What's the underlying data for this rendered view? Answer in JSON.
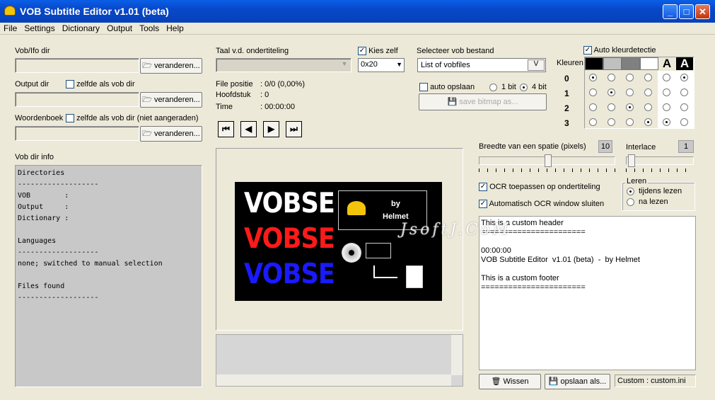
{
  "window": {
    "title": "VOB Subtitle Editor v1.01 (beta)",
    "min": "_",
    "max": "□",
    "close": "✕"
  },
  "menu": [
    "File",
    "Settings",
    "Dictionary",
    "Output",
    "Tools",
    "Help"
  ],
  "left": {
    "vobifo_label": "Vob/Ifo dir",
    "output_label": "Output dir",
    "output_same": "zelfde als vob dir",
    "dict_label": "Woordenboek",
    "dict_same": "zelfde als vob dir (niet aangeraden)",
    "change_btn": "veranderen...",
    "info_label": "Vob dir info",
    "info_text": "Directories\n-------------------\nVOB        :\nOutput     :\nDictionary :\n\nLanguages\n-------------------\nnone; switched to manual selection\n\nFiles found\n-------------------"
  },
  "mid": {
    "lang_label": "Taal v.d. ondertiteling",
    "kies_zelf": "Kies zelf",
    "hex_value": "0x20",
    "file_pos_label": "File positie",
    "file_pos_value": ": 0/0  (0,00%)",
    "chapter_label": "Hoofdstuk",
    "chapter_value": ": 0",
    "time_label": "Time",
    "time_value": ": 00:00:00",
    "logo_words": [
      "VOBSE",
      "VOBSE",
      "VOBSE"
    ],
    "logo_colors": [
      "#ffffff",
      "#ff1a1a",
      "#1a1aff"
    ],
    "logo_by": "by",
    "logo_author": "Helmet"
  },
  "vob": {
    "select_label": "Selecteer vob bestand",
    "list_value": "List of vobfiles",
    "auto_save": "auto opslaan",
    "bit1": "1 bit",
    "bit4": "4 bit",
    "save_bitmap": "save bitmap as..."
  },
  "colors": {
    "auto_detect": "Auto kleurdetectie",
    "kleuren": "Kleuren",
    "rows": [
      "0",
      "1",
      "2",
      "3"
    ],
    "swatches": [
      "#000000",
      "#c0c0c0",
      "#808080",
      "#ffffff"
    ]
  },
  "right": {
    "space_label": "Breedte van een spatie (pixels)",
    "space_value": "10",
    "interlace_label": "Interlace",
    "interlace_value": "1",
    "ocr_apply": "OCR toepassen op ondertiteling",
    "ocr_close": "Automatisch OCR window sluiten",
    "leren_label": "Leren",
    "leren_opt1": "tijdens lezen",
    "leren_opt2": "na lezen",
    "output_text": "This is a custom header\n=======================\n\n00:00:00\nVOB Subtitle Editor  v1.01 (beta)  -  by Helmet\n\nThis is a custom footer\n=======================",
    "wissen": "Wissen",
    "opslaan": "opslaan als...",
    "status": "Custom : custom.ini",
    "watermark": "JsoftJ.CoM"
  }
}
